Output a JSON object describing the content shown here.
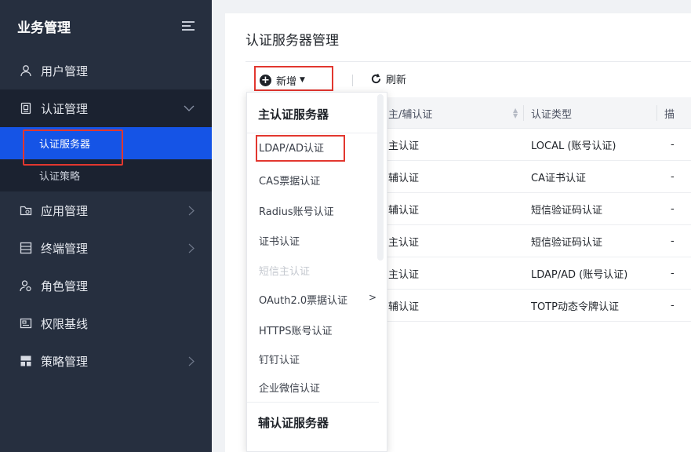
{
  "sidebar": {
    "title": "业务管理",
    "items": [
      {
        "label": "用户管理",
        "icon": "user-icon"
      },
      {
        "label": "认证管理",
        "icon": "certificate-icon",
        "open": true,
        "children": [
          {
            "label": "认证服务器",
            "active": true
          },
          {
            "label": "认证策略",
            "active": false
          }
        ]
      },
      {
        "label": "应用管理",
        "icon": "app-folder-icon"
      },
      {
        "label": "终端管理",
        "icon": "terminal-icon"
      },
      {
        "label": "角色管理",
        "icon": "role-icon"
      },
      {
        "label": "权限基线",
        "icon": "permission-icon"
      },
      {
        "label": "策略管理",
        "icon": "policy-icon"
      }
    ]
  },
  "page": {
    "title": "认证服务器管理",
    "toolbar": {
      "add_label": "新增",
      "refresh_label": "刷新"
    }
  },
  "table": {
    "columns": [
      "主/辅认证",
      "认证类型",
      "描"
    ],
    "rows": [
      {
        "role": "主认证",
        "type": "LOCAL (账号认证)",
        "desc": "-"
      },
      {
        "role": "辅认证",
        "type": "CA证书认证",
        "desc": "-"
      },
      {
        "role": "辅认证",
        "type": "短信验证码认证",
        "desc": "-"
      },
      {
        "role": "主认证",
        "type": "短信验证码认证",
        "desc": "-"
      },
      {
        "role": "主认证",
        "type": "LDAP/AD (账号认证)",
        "desc": "-"
      },
      {
        "role": "辅认证",
        "type": "TOTP动态令牌认证",
        "desc": "-"
      }
    ]
  },
  "dropdown": {
    "primary_group": "主认证服务器",
    "items": [
      {
        "label": "LDAP/AD认证",
        "disabled": false
      },
      {
        "label": "CAS票据认证",
        "disabled": false
      },
      {
        "label": "Radius账号认证",
        "disabled": false
      },
      {
        "label": "证书认证",
        "disabled": false
      },
      {
        "label": "短信主认证",
        "disabled": true
      },
      {
        "label": "OAuth2.0票据认证",
        "disabled": false,
        "has_submenu": true,
        "submenu_arrow": ">"
      },
      {
        "label": "HTTPS账号认证",
        "disabled": false
      },
      {
        "label": "钉钉认证",
        "disabled": false
      },
      {
        "label": "企业微信认证",
        "disabled": false
      }
    ],
    "secondary_group": "辅认证服务器"
  },
  "colors": {
    "sidebar_bg": "#262f3f",
    "active_item": "#1554e6",
    "highlight_border": "#e2372f"
  }
}
